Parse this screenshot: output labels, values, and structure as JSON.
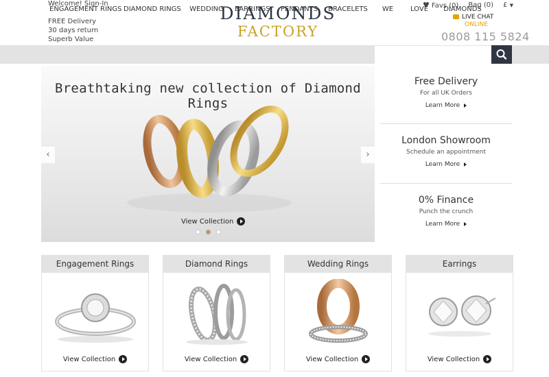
{
  "header": {
    "welcome": "Welcome! Sign-In",
    "perks": [
      "FREE Delivery",
      "30 days return",
      "Superb Value"
    ],
    "logo_line1": "DIAMONDS",
    "logo_line2": "FACTORY",
    "favs": "Favs (0)",
    "bag": "Bag (0)",
    "currency": "£",
    "live_chat": "LIVE CHAT",
    "live_chat_status": "ONLINE",
    "phone": "0808 115 5824"
  },
  "nav": {
    "items": [
      "ENGAGEMENT RINGS",
      "DIAMOND RINGS",
      "WEDDING",
      "EARRINGS",
      "PENDANTS",
      "BRACELETS",
      "WE",
      "LOVE",
      "DIAMONDS"
    ]
  },
  "banner": {
    "title": "Breathtaking new collection of Diamond Rings",
    "cta": "View Collection",
    "prev": "‹",
    "next": "›"
  },
  "info": [
    {
      "title": "Free Delivery",
      "sub": "For all UK Orders",
      "link": "Learn More"
    },
    {
      "title": "London Showroom",
      "sub": "Schedule an appointment",
      "link": "Learn More"
    },
    {
      "title": "0% Finance",
      "sub": "Punch the crunch",
      "link": "Learn More"
    }
  ],
  "categories": [
    {
      "title": "Engagement Rings",
      "cta": "View Collection"
    },
    {
      "title": "Diamond Rings",
      "cta": "View Collection"
    },
    {
      "title": "Wedding Rings",
      "cta": "View Collection"
    },
    {
      "title": "Earrings",
      "cta": "View Collection"
    }
  ],
  "colors": {
    "gold": "#c9a227",
    "navy": "#2c3446",
    "nav_bg": "#e3e3e3",
    "live_chat_orange": "#e6a300"
  }
}
